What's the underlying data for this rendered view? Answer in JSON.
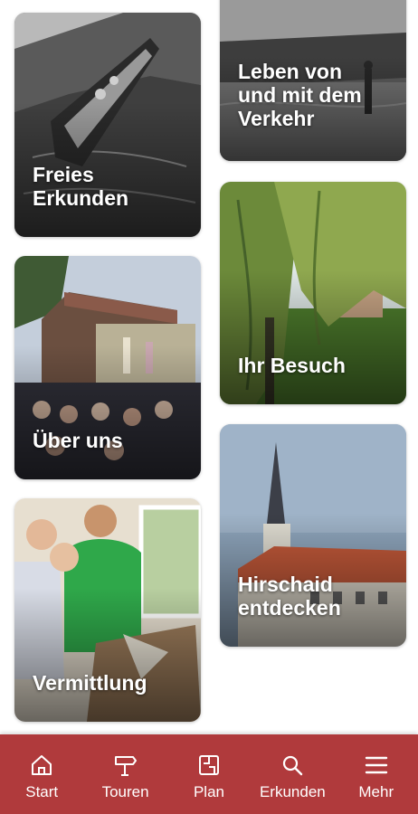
{
  "tiles": [
    {
      "id": "freies-erkunden",
      "label": "Freies\nErkunden"
    },
    {
      "id": "verkehr",
      "label": "Leben von\nund mit dem\nVerkehr"
    },
    {
      "id": "ihr-besuch",
      "label": "Ihr Besuch"
    },
    {
      "id": "ueber-uns",
      "label": "Über uns"
    },
    {
      "id": "hirschaid",
      "label": "Hirschaid\nentdecken"
    },
    {
      "id": "vermittlung",
      "label": "Vermittlung"
    }
  ],
  "nav": {
    "items": [
      {
        "label": "Start",
        "icon": "home-icon"
      },
      {
        "label": "Touren",
        "icon": "signpost-icon"
      },
      {
        "label": "Plan",
        "icon": "map-icon"
      },
      {
        "label": "Erkunden",
        "icon": "search-icon"
      },
      {
        "label": "Mehr",
        "icon": "menu-icon"
      }
    ]
  },
  "colors": {
    "nav_background": "#b03a3c",
    "nav_foreground": "#ffffff"
  }
}
